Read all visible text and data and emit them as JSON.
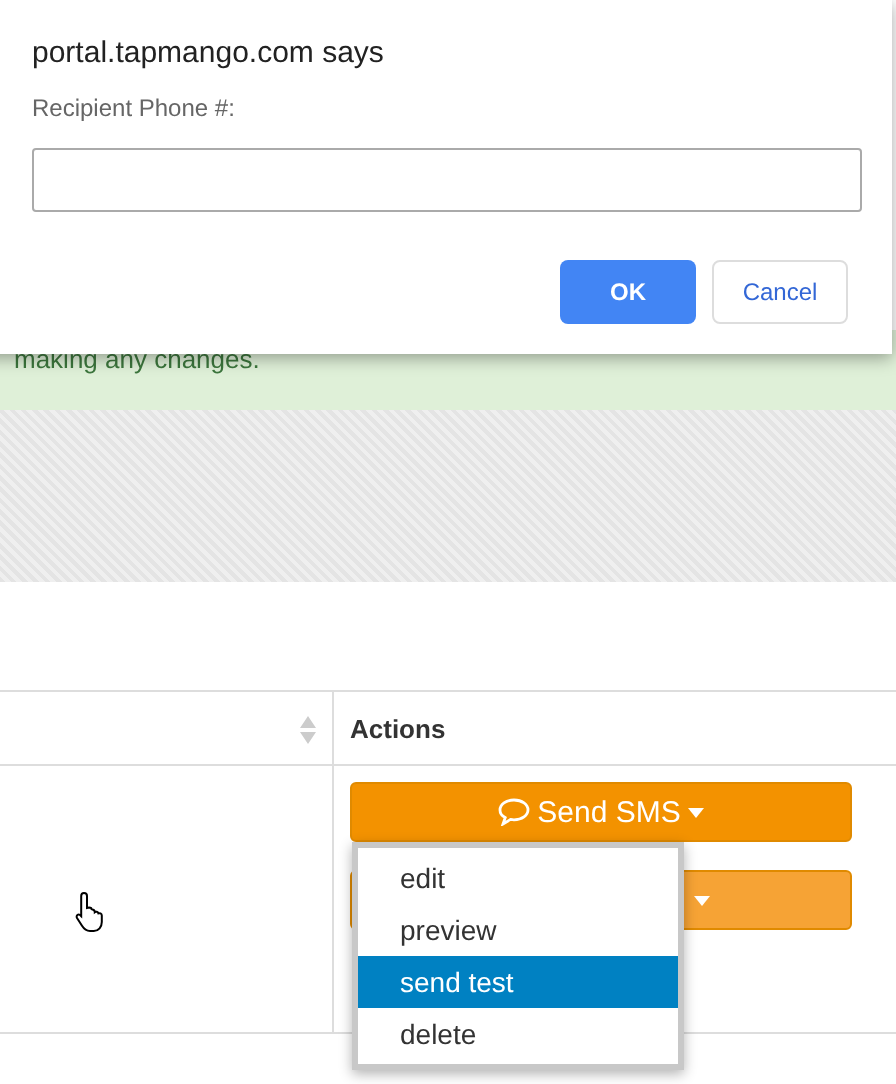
{
  "dialog": {
    "title": "portal.tapmango.com says",
    "prompt": "Recipient Phone #:",
    "buttons": [
      {
        "label": "OK",
        "kind": "primary"
      },
      {
        "label": "Cancel",
        "kind": "secondary"
      }
    ]
  },
  "alert": {
    "text": "making any changes."
  },
  "table": {
    "columns": [
      {
        "sortable": true
      },
      {
        "label": "Actions",
        "sortable": false
      }
    ],
    "row": {
      "actions": [
        {
          "label": "Send SMS",
          "kind": "sms"
        },
        {
          "kind": "dropdown"
        }
      ]
    }
  },
  "menu": {
    "items": [
      {
        "label": "edit",
        "selected": false
      },
      {
        "label": "preview",
        "selected": false
      },
      {
        "label": "send test",
        "selected": true
      },
      {
        "label": "delete",
        "selected": false
      }
    ]
  }
}
